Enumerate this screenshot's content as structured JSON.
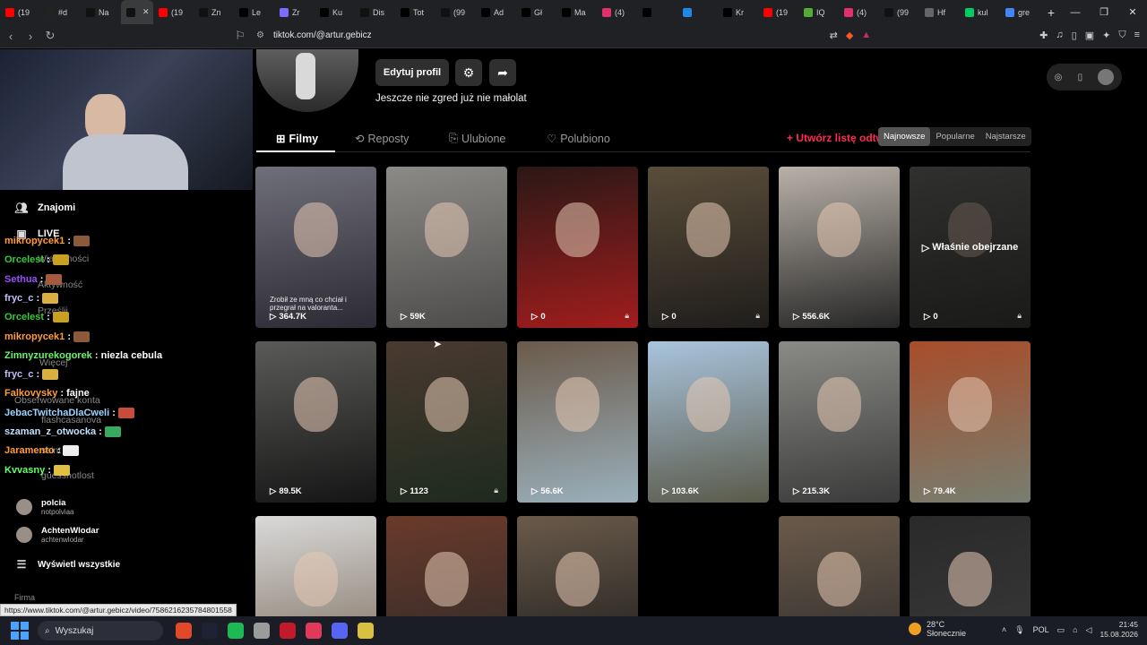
{
  "browser": {
    "tabs": [
      {
        "label": "(19",
        "color": "#ff0000"
      },
      {
        "label": "#d",
        "color": "#222"
      },
      {
        "label": "Na",
        "color": "#111"
      },
      {
        "label": "",
        "color": "#111",
        "active": true
      },
      {
        "label": "(19",
        "color": "#ff0000"
      },
      {
        "label": "Zn",
        "color": "#111"
      },
      {
        "label": "Le",
        "color": "#000"
      },
      {
        "label": "Zr",
        "color": "#7b6cff"
      },
      {
        "label": "Ku",
        "color": "#000"
      },
      {
        "label": "Dis",
        "color": "#111"
      },
      {
        "label": "Tot",
        "color": "#000"
      },
      {
        "label": "(99",
        "color": "#111"
      },
      {
        "label": "Ad",
        "color": "#000"
      },
      {
        "label": "Gł",
        "color": "#000"
      },
      {
        "label": "Ma",
        "color": "#000"
      },
      {
        "label": "(4)",
        "color": "#e1306c"
      },
      {
        "label": "",
        "color": "#000"
      },
      {
        "label": "",
        "color": "#1e88e5"
      },
      {
        "label": "Kr",
        "color": "#000"
      },
      {
        "label": "(19",
        "color": "#ff0000"
      },
      {
        "label": "IQ",
        "color": "#55aa33"
      },
      {
        "label": "(4)",
        "color": "#e1306c"
      },
      {
        "label": "(99",
        "color": "#111"
      },
      {
        "label": "Hf",
        "color": "#666"
      },
      {
        "label": "kul",
        "color": "#00cc66"
      },
      {
        "label": "gre",
        "color": "#4285f4"
      }
    ],
    "new_tab": "+",
    "url": "tiktok.com/@artur.gebicz",
    "status_url": "https://www.tiktok.com/@artur.gebicz/video/7586216235784801558"
  },
  "profile": {
    "edit_label": "Edytuj profil",
    "bio": "Jeszcze nie zgred już nie małolat",
    "tabs": [
      {
        "label": "Filmy",
        "icon": "grid-icon"
      },
      {
        "label": "Reposty",
        "icon": "repost-icon"
      },
      {
        "label": "Ulubione",
        "icon": "bookmark-icon"
      },
      {
        "label": "Polubiono",
        "icon": "heart-icon"
      }
    ],
    "create_list": "+ Utwórz listę odtwarzania",
    "sort": [
      "Najnowsze",
      "Popularne",
      "Najstarsze"
    ]
  },
  "videos": [
    {
      "views": "364.7K",
      "caption": "Zrobił ze mną co chciał i przegrał na valoranta...",
      "colors": [
        "#6f6f7a",
        "#2c2a33"
      ],
      "locked": false
    },
    {
      "views": "59K",
      "colors": [
        "#8c8a87",
        "#4e4c4a"
      ],
      "locked": false
    },
    {
      "views": "0",
      "colors": [
        "#2a1816",
        "#a11d1d"
      ],
      "locked": true
    },
    {
      "views": "0",
      "colors": [
        "#5a4d3a",
        "#1f1d1b"
      ],
      "locked": true
    },
    {
      "views": "556.6K",
      "colors": [
        "#b8b1a8",
        "#262626"
      ],
      "locked": false
    },
    {
      "views": "0",
      "colors": [
        "#6a6a66",
        "#3a3a38"
      ],
      "locked": true,
      "overlay": "Właśnie obejrzane"
    },
    {
      "views": "89.5K",
      "colors": [
        "#5a5a58",
        "#151515"
      ],
      "locked": false
    },
    {
      "views": "1123",
      "colors": [
        "#4a3a30",
        "#1d2a1d"
      ],
      "locked": true
    },
    {
      "views": "56.6K",
      "colors": [
        "#6b5a4a",
        "#9ab0bb"
      ],
      "locked": false
    },
    {
      "views": "103.6K",
      "colors": [
        "#a9c4dd",
        "#5a5a4a"
      ],
      "locked": false
    },
    {
      "views": "215.3K",
      "colors": [
        "#8a8a86",
        "#3a3a3a"
      ],
      "locked": false
    },
    {
      "views": "79.4K",
      "colors": [
        "#a84d2a",
        "#777e70"
      ],
      "locked": false
    },
    {
      "views": "",
      "colors": [
        "#d9d9d9",
        "#7a6a5a"
      ],
      "locked": false
    },
    {
      "views": "",
      "colors": [
        "#6a3a2a",
        "#2a2a2a"
      ],
      "locked": false
    },
    {
      "views": "",
      "colors": [
        "#6a5a4a",
        "#1a1a1a"
      ],
      "locked": false
    },
    null,
    {
      "views": "",
      "colors": [
        "#6b5a4a",
        "#2a2a2a"
      ],
      "locked": false
    },
    {
      "views": "",
      "colors": [
        "#2a2a2a",
        "#3a3a3a"
      ],
      "locked": false
    }
  ],
  "sidebar": {
    "nav": [
      {
        "label": "Znajomi",
        "icon": "friends-icon"
      },
      {
        "label": "LIVE",
        "icon": "live-icon"
      }
    ],
    "ghost_labels": [
      "Wiadomości",
      "Aktywność",
      "Prześlij",
      "Więcej",
      "Obserwowane konta",
      "flashcasanova",
      "saint",
      "guessnotlost"
    ],
    "follows": [
      {
        "name": "polcia",
        "handle": "notpolviaa"
      },
      {
        "name": "AchtenWlodar",
        "handle": "achtenwlodar"
      }
    ],
    "show_all": "Wyświetl wszystkie",
    "firma": "Firma"
  },
  "chat": [
    {
      "user": "mikropycek1",
      "color": "#ff9d3b",
      "msg": ":",
      "emote": "#8b5a3a"
    },
    {
      "user": "Orcelest",
      "color": "#33cc33",
      "msg": ":",
      "emote": "#c9a020"
    },
    {
      "user": "Sethua",
      "color": "#9b4dff",
      "msg": ":",
      "emote": "#a55a40"
    },
    {
      "user": "fryc_c",
      "color": "#c0c0ff",
      "msg": ":",
      "emote": "#d9b040"
    },
    {
      "user": "Orcelest",
      "color": "#33cc33",
      "msg": ":",
      "emote": "#c9a020"
    },
    {
      "user": "mikropycek1",
      "color": "#ff9d3b",
      "msg": ":",
      "emote": "#8b5a3a"
    },
    {
      "user": "Zimnyzurekogorek",
      "color": "#6cf26c",
      "msg": ": niezla cebula",
      "emote": ""
    },
    {
      "user": "fryc_c",
      "color": "#c0c0ff",
      "msg": ":",
      "emote": "#d9b040"
    },
    {
      "user": "Falkovysky",
      "color": "#ff9d3b",
      "msg": ": fajne",
      "emote": ""
    },
    {
      "user": "JebacTwitchaDlaCweli",
      "color": "#9fd3ff",
      "msg": ":",
      "emote": "#c84c3a"
    },
    {
      "user": "szaman_z_otwocka",
      "color": "#bde0ff",
      "msg": ":",
      "emote": "#3aa860"
    },
    {
      "user": "Jaramento",
      "color": "#ff9d3b",
      "msg": ":",
      "emote": "#eeeeee"
    },
    {
      "user": "Kvvasny",
      "color": "#66ff66",
      "msg": ":",
      "emote": "#e0c040"
    }
  ],
  "taskbar": {
    "search": "Wyszukaj",
    "weather_temp": "28°C",
    "weather_desc": "Słonecznie",
    "lang": "POL",
    "time": "21:45",
    "date": "15.08.2026",
    "apps": [
      "#e04a2a",
      "#1e2233",
      "#1db954",
      "#9b9b9b",
      "#c21a2a",
      "#e03a5a",
      "#5865f2",
      "#d8c040"
    ]
  }
}
